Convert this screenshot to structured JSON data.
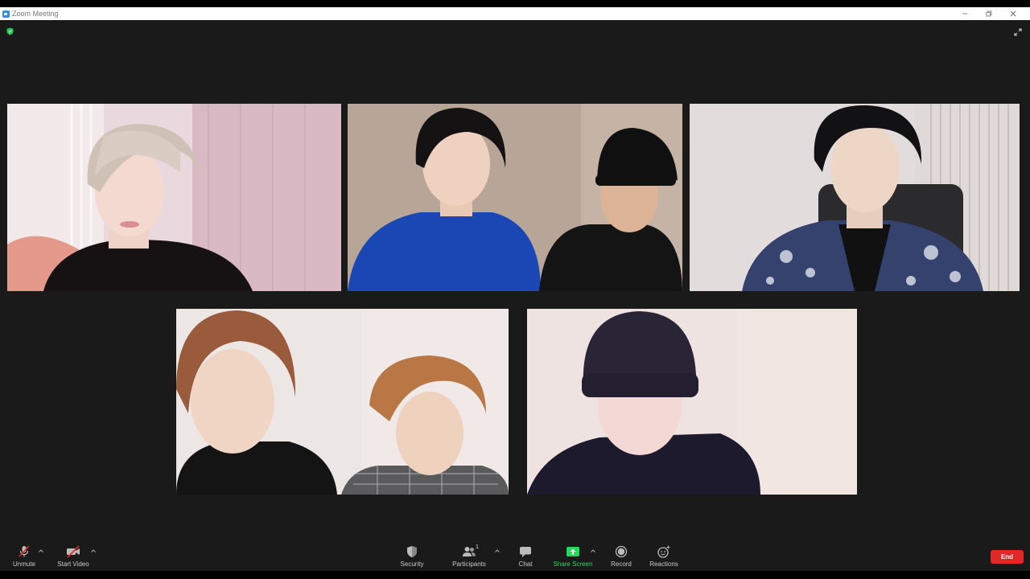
{
  "window": {
    "title": "Zoom Meeting"
  },
  "toolbar": {
    "unmute_label": "Unmute",
    "start_video_label": "Start Video",
    "security_label": "Security",
    "participants_label": "Participants",
    "participants_count": "1",
    "chat_label": "Chat",
    "share_screen_label": "Share Screen",
    "record_label": "Record",
    "reactions_label": "Reactions",
    "end_label": "End"
  },
  "colors": {
    "background": "#1a1a1a",
    "share_green": "#23d959",
    "end_red": "#e02828",
    "zoom_blue": "#2d8cff",
    "shield_green": "#23c552"
  },
  "icons": {
    "app": "zoom-app-icon",
    "shield": "encryption-shield-icon",
    "fullscreen": "enter-fullscreen-icon",
    "unmute": "muted-microphone-icon",
    "start_video": "video-off-icon",
    "security": "security-shield-icon",
    "participants": "participants-icon",
    "chat": "chat-bubble-icon",
    "share": "share-screen-arrow-icon",
    "record": "record-icon",
    "reactions": "emoji-plus-icon"
  }
}
